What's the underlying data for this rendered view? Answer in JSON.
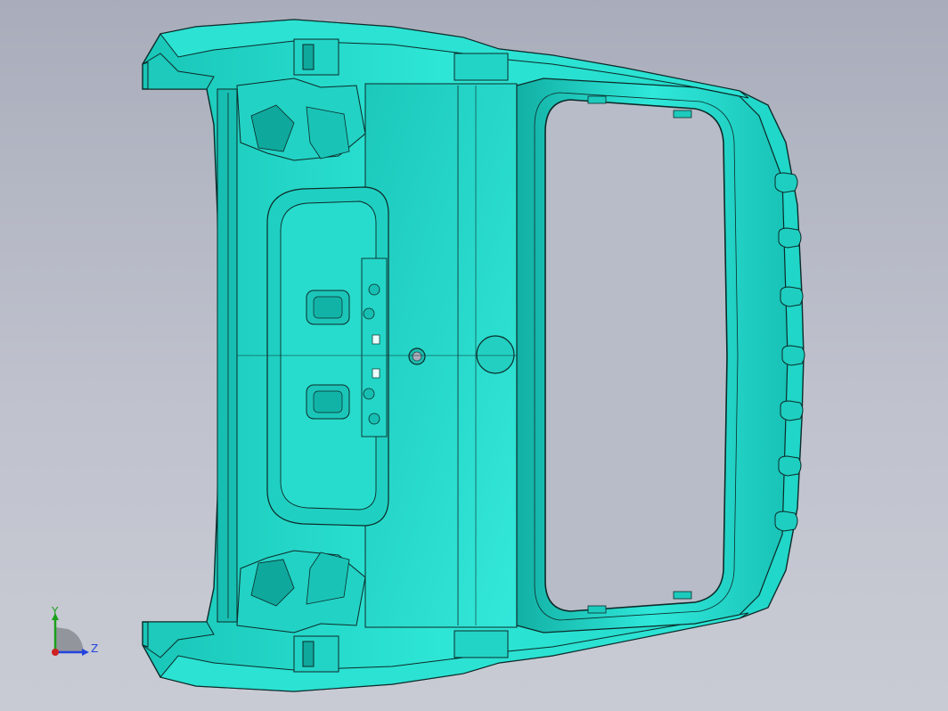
{
  "view": {
    "background_top": "#a9adbb",
    "background_bottom": "#c9cbd4"
  },
  "model": {
    "shade_light": "#3ef0e0",
    "shade_mid": "#22d8c8",
    "shade_dark": "#14b2a6",
    "edge_color": "#0c2a28"
  },
  "triad": {
    "y_label": "Y",
    "z_label": "Z",
    "y_color": "#1aa01a",
    "z_color": "#2244dd",
    "x_color": "#cc2222"
  }
}
